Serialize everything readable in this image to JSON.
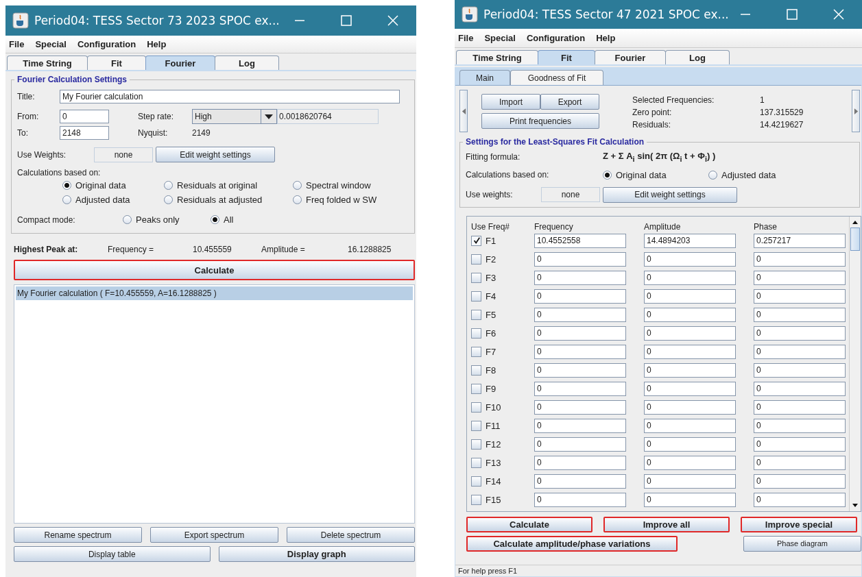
{
  "fourier_window": {
    "title": "Period04: TESS Sector 73 2023 SPOC ex...",
    "menu": [
      "File",
      "Special",
      "Configuration",
      "Help"
    ],
    "tabs": [
      {
        "label": "Time String",
        "selected": false
      },
      {
        "label": "Fit",
        "selected": false
      },
      {
        "label": "Fourier",
        "selected": true
      },
      {
        "label": "Log",
        "selected": false
      }
    ],
    "settings": {
      "group_title": "Fourier Calculation Settings",
      "title_label": "Title:",
      "title_value": "My Fourier calculation",
      "from_label": "From:",
      "from_value": "0",
      "to_label": "To:",
      "to_value": "2148",
      "step_rate_label": "Step rate:",
      "step_rate_value": "High",
      "step_value": "0.0018620764",
      "nyquist_label": "Nyquist:",
      "nyquist_value": "2149",
      "weights_label": "Use Weights:",
      "weights_value": "none",
      "edit_weights_button": "Edit weight settings",
      "based_on_label": "Calculations based on:",
      "based_on_options": [
        {
          "label": "Original data",
          "selected": true
        },
        {
          "label": "Residuals at original",
          "selected": false
        },
        {
          "label": "Spectral window",
          "selected": false
        },
        {
          "label": "Adjusted data",
          "selected": false
        },
        {
          "label": "Residuals at adjusted",
          "selected": false
        },
        {
          "label": "Freq folded w SW",
          "selected": false
        }
      ],
      "compact_label": "Compact mode:",
      "compact_options": [
        {
          "label": "Peaks only",
          "selected": false
        },
        {
          "label": "All",
          "selected": true
        }
      ]
    },
    "peak": {
      "label": "Highest Peak at:",
      "frequency_label": "Frequency =",
      "frequency_value": "10.455559",
      "amplitude_label": "Amplitude =",
      "amplitude_value": "16.1288825"
    },
    "calculate_button": {
      "label": "Calculate",
      "bold": true,
      "highlighted": true
    },
    "spectra": [
      {
        "label": "My Fourier calculation ( F=10.455559, A=16.1288825 )",
        "selected": true
      }
    ],
    "buttons_row_1": [
      {
        "label": "Rename spectrum",
        "bold": false,
        "highlighted": false
      },
      {
        "label": "Export spectrum",
        "bold": false,
        "highlighted": false
      },
      {
        "label": "Delete spectrum",
        "bold": false,
        "highlighted": false
      }
    ],
    "buttons_row_2": [
      {
        "label": "Display table",
        "bold": false,
        "highlighted": false
      },
      {
        "label": "Display graph",
        "bold": true,
        "highlighted": false
      }
    ]
  },
  "fit_window": {
    "title": "Period04: TESS Sector 47 2021 SPOC ex...",
    "menu": [
      "File",
      "Special",
      "Configuration",
      "Help"
    ],
    "tabs": [
      {
        "label": "Time String",
        "selected": false
      },
      {
        "label": "Fit",
        "selected": true
      },
      {
        "label": "Fourier",
        "selected": false
      },
      {
        "label": "Log",
        "selected": false
      }
    ],
    "subtabs": [
      {
        "label": "Main",
        "selected": true
      },
      {
        "label": "Goodness of Fit",
        "selected": false
      }
    ],
    "import_button": "Import",
    "export_button": "Export",
    "print_button": "Print frequencies",
    "stats": [
      {
        "label": "Selected Frequencies:",
        "value": "1"
      },
      {
        "label": "Zero point:",
        "value": "137.315529"
      },
      {
        "label": "Residuals:",
        "value": "14.4219627"
      }
    ],
    "group_title": "Settings for the Least-Squares Fit Calculation",
    "formula_label": "Fitting formula:",
    "formula": "Z + Σ A$_{i}$ sin( 2π (Ω$_{i}$ t + Φ$_{i}$) )",
    "based_on_label": "Calculations based on:",
    "based_on_options": [
      {
        "label": "Original data",
        "selected": true
      },
      {
        "label": "Adjusted data",
        "selected": false
      }
    ],
    "weights_label": "Use weights:",
    "weights_value": "none",
    "edit_weights_button": "Edit weight settings",
    "columns": [
      "Use Freq#",
      "Frequency",
      "Amplitude",
      "Phase"
    ],
    "rows": [
      {
        "label": "F1",
        "checked": true,
        "frequency": "10.4552558",
        "amplitude": "14.4894203",
        "phase": "0.257217"
      },
      {
        "label": "F2",
        "checked": false,
        "frequency": "0",
        "amplitude": "0",
        "phase": "0"
      },
      {
        "label": "F3",
        "checked": false,
        "frequency": "0",
        "amplitude": "0",
        "phase": "0"
      },
      {
        "label": "F4",
        "checked": false,
        "frequency": "0",
        "amplitude": "0",
        "phase": "0"
      },
      {
        "label": "F5",
        "checked": false,
        "frequency": "0",
        "amplitude": "0",
        "phase": "0"
      },
      {
        "label": "F6",
        "checked": false,
        "frequency": "0",
        "amplitude": "0",
        "phase": "0"
      },
      {
        "label": "F7",
        "checked": false,
        "frequency": "0",
        "amplitude": "0",
        "phase": "0"
      },
      {
        "label": "F8",
        "checked": false,
        "frequency": "0",
        "amplitude": "0",
        "phase": "0"
      },
      {
        "label": "F9",
        "checked": false,
        "frequency": "0",
        "amplitude": "0",
        "phase": "0"
      },
      {
        "label": "F10",
        "checked": false,
        "frequency": "0",
        "amplitude": "0",
        "phase": "0"
      },
      {
        "label": "F11",
        "checked": false,
        "frequency": "0",
        "amplitude": "0",
        "phase": "0"
      },
      {
        "label": "F12",
        "checked": false,
        "frequency": "0",
        "amplitude": "0",
        "phase": "0"
      },
      {
        "label": "F13",
        "checked": false,
        "frequency": "0",
        "amplitude": "0",
        "phase": "0"
      },
      {
        "label": "F14",
        "checked": false,
        "frequency": "0",
        "amplitude": "0",
        "phase": "0"
      },
      {
        "label": "F15",
        "checked": false,
        "frequency": "0",
        "amplitude": "0",
        "phase": "0"
      }
    ],
    "action_buttons": [
      {
        "label": "Calculate",
        "bold": true,
        "highlighted": true
      },
      {
        "label": "Improve all",
        "bold": true,
        "highlighted": true
      },
      {
        "label": "Improve special",
        "bold": true,
        "highlighted": true
      }
    ],
    "action_buttons_2": [
      {
        "label": "Calculate amplitude/phase variations",
        "bold": true,
        "highlighted": true
      },
      {
        "label": "Phase diagram",
        "bold": false,
        "highlighted": false
      }
    ],
    "status": "For help press F1"
  }
}
